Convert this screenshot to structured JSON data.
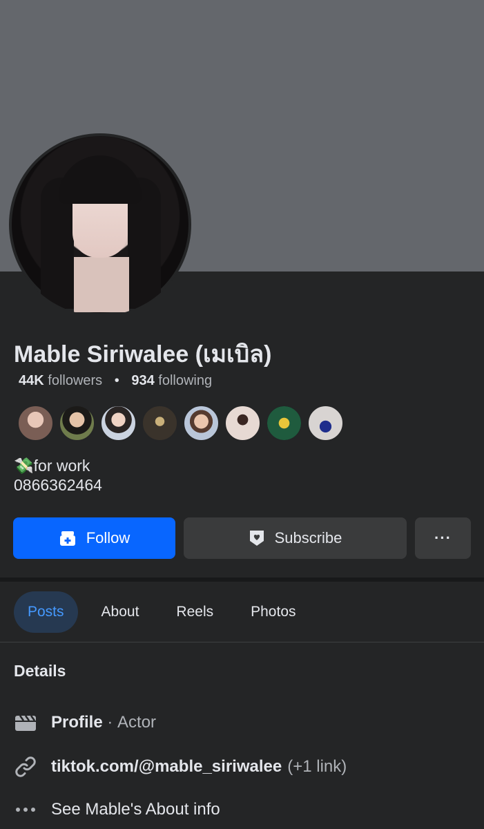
{
  "profile": {
    "name": "Mable Siriwalee (เมเบิล)",
    "followers_count": "44K",
    "followers_label": "followers",
    "following_count": "934",
    "following_label": "following",
    "bio_line1": "💸for work",
    "bio_line2": "0866362464"
  },
  "friends": [
    {
      "name": "friend-1",
      "color": "#c9a59a"
    },
    {
      "name": "friend-2",
      "color": "#6f7c4c"
    },
    {
      "name": "friend-3",
      "color": "#cbd3e0"
    },
    {
      "name": "friend-4",
      "color": "#3a332b"
    },
    {
      "name": "friend-5",
      "color": "#b9c6d9"
    },
    {
      "name": "friend-6",
      "color": "#e7d9d3"
    },
    {
      "name": "friend-7",
      "color": "#1f5b3e"
    },
    {
      "name": "friend-8",
      "color": "#d8d4d2"
    }
  ],
  "actions": {
    "follow_label": "Follow",
    "subscribe_label": "Subscribe",
    "more_label": "···"
  },
  "tabs": [
    {
      "label": "Posts",
      "active": true
    },
    {
      "label": "About",
      "active": false
    },
    {
      "label": "Reels",
      "active": false
    },
    {
      "label": "Photos",
      "active": false
    }
  ],
  "details": {
    "title": "Details",
    "profile_label": "Profile",
    "profile_sep": " · ",
    "profile_value": "Actor",
    "link_text": "tiktok.com/@mable_siriwalee",
    "link_extra": "(+1 link)",
    "about_text": "See Mable's About info"
  },
  "colors": {
    "background": "#242526",
    "cover": "#64676c",
    "primary": "#0866ff",
    "secondary_button": "#3a3b3c",
    "active_tab_text": "#4599ff"
  }
}
